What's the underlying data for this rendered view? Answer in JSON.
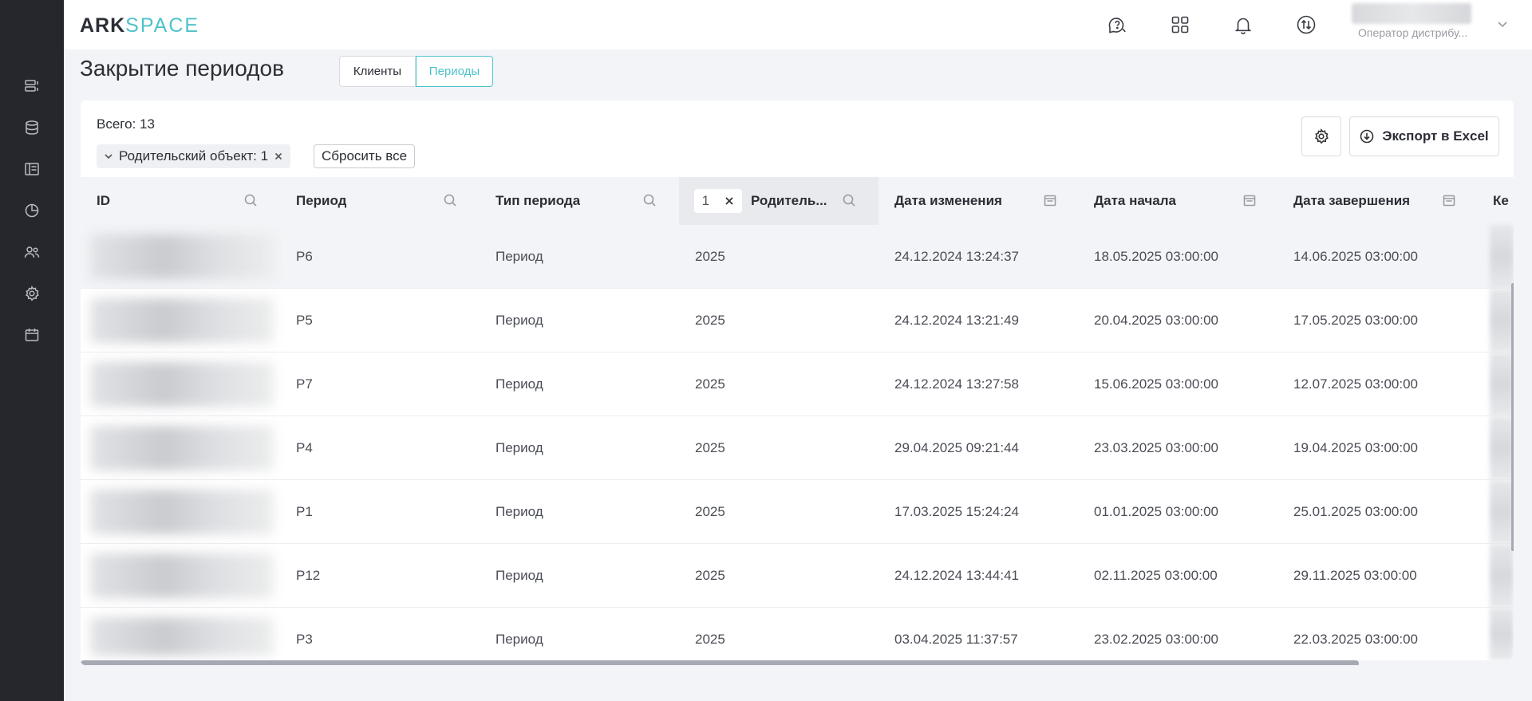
{
  "logo": {
    "part1": "ARK",
    "part2": "SPACE"
  },
  "header": {
    "icons": [
      "help-chat-icon",
      "apps-grid-icon",
      "bell-icon",
      "switch-icon"
    ],
    "user_role": "Оператор дистрибу...",
    "chevron": "chevron-down-icon"
  },
  "sidebar": {
    "items": [
      "list-icon",
      "database-icon",
      "layout-icon",
      "chart-pie-icon",
      "users-icon",
      "settings-icon",
      "calendar-icon"
    ]
  },
  "page": {
    "title": "Закрытие периодов",
    "tabs": [
      "Клиенты",
      "Периоды"
    ],
    "active_tab": "Периоды"
  },
  "toolbar": {
    "total": "Всего: 13",
    "filter_chip": "Родительский объект: 1",
    "reset_label": "Сбросить все",
    "export_label": "Экспорт в Excel"
  },
  "table": {
    "columns": [
      "ID",
      "Период",
      "Тип периода",
      "Родитель...",
      "Дата изменения",
      "Дата начала",
      "Дата завершения",
      "Ке"
    ],
    "parent_filter_count": "1",
    "rows": [
      {
        "period": "P6",
        "type": "Период",
        "parent": "2025",
        "changed": "24.12.2024 13:24:37",
        "start": "18.05.2025 03:00:00",
        "end": "14.06.2025 03:00:00"
      },
      {
        "period": "P5",
        "type": "Период",
        "parent": "2025",
        "changed": "24.12.2024 13:21:49",
        "start": "20.04.2025 03:00:00",
        "end": "17.05.2025 03:00:00"
      },
      {
        "period": "P7",
        "type": "Период",
        "parent": "2025",
        "changed": "24.12.2024 13:27:58",
        "start": "15.06.2025 03:00:00",
        "end": "12.07.2025 03:00:00"
      },
      {
        "period": "P4",
        "type": "Период",
        "parent": "2025",
        "changed": "29.04.2025 09:21:44",
        "start": "23.03.2025 03:00:00",
        "end": "19.04.2025 03:00:00"
      },
      {
        "period": "P1",
        "type": "Период",
        "parent": "2025",
        "changed": "17.03.2025 15:24:24",
        "start": "01.01.2025 03:00:00",
        "end": "25.01.2025 03:00:00"
      },
      {
        "period": "P12",
        "type": "Период",
        "parent": "2025",
        "changed": "24.12.2024 13:44:41",
        "start": "02.11.2025 03:00:00",
        "end": "29.11.2025 03:00:00"
      },
      {
        "period": "P3",
        "type": "Период",
        "parent": "2025",
        "changed": "03.04.2025 11:37:57",
        "start": "23.02.2025 03:00:00",
        "end": "22.03.2025 03:00:00"
      }
    ]
  }
}
